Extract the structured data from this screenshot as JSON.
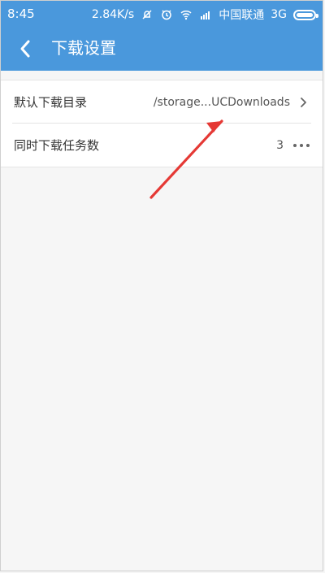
{
  "status_bar": {
    "time": "8:45",
    "speed": "2.84K/s",
    "carrier": "中国联通",
    "network": "3G",
    "colors": {
      "bar": "#4a98dc",
      "text": "#ffffff"
    }
  },
  "app_bar": {
    "title": "下载设置"
  },
  "settings": {
    "items": [
      {
        "label": "默认下载目录",
        "value": "/storage...UCDownloads",
        "icon": "chevron-right-icon"
      },
      {
        "label": "同时下载任务数",
        "value": "3",
        "icon": "more-icon"
      }
    ]
  },
  "annotation": {
    "type": "arrow",
    "color": "#e53935"
  }
}
